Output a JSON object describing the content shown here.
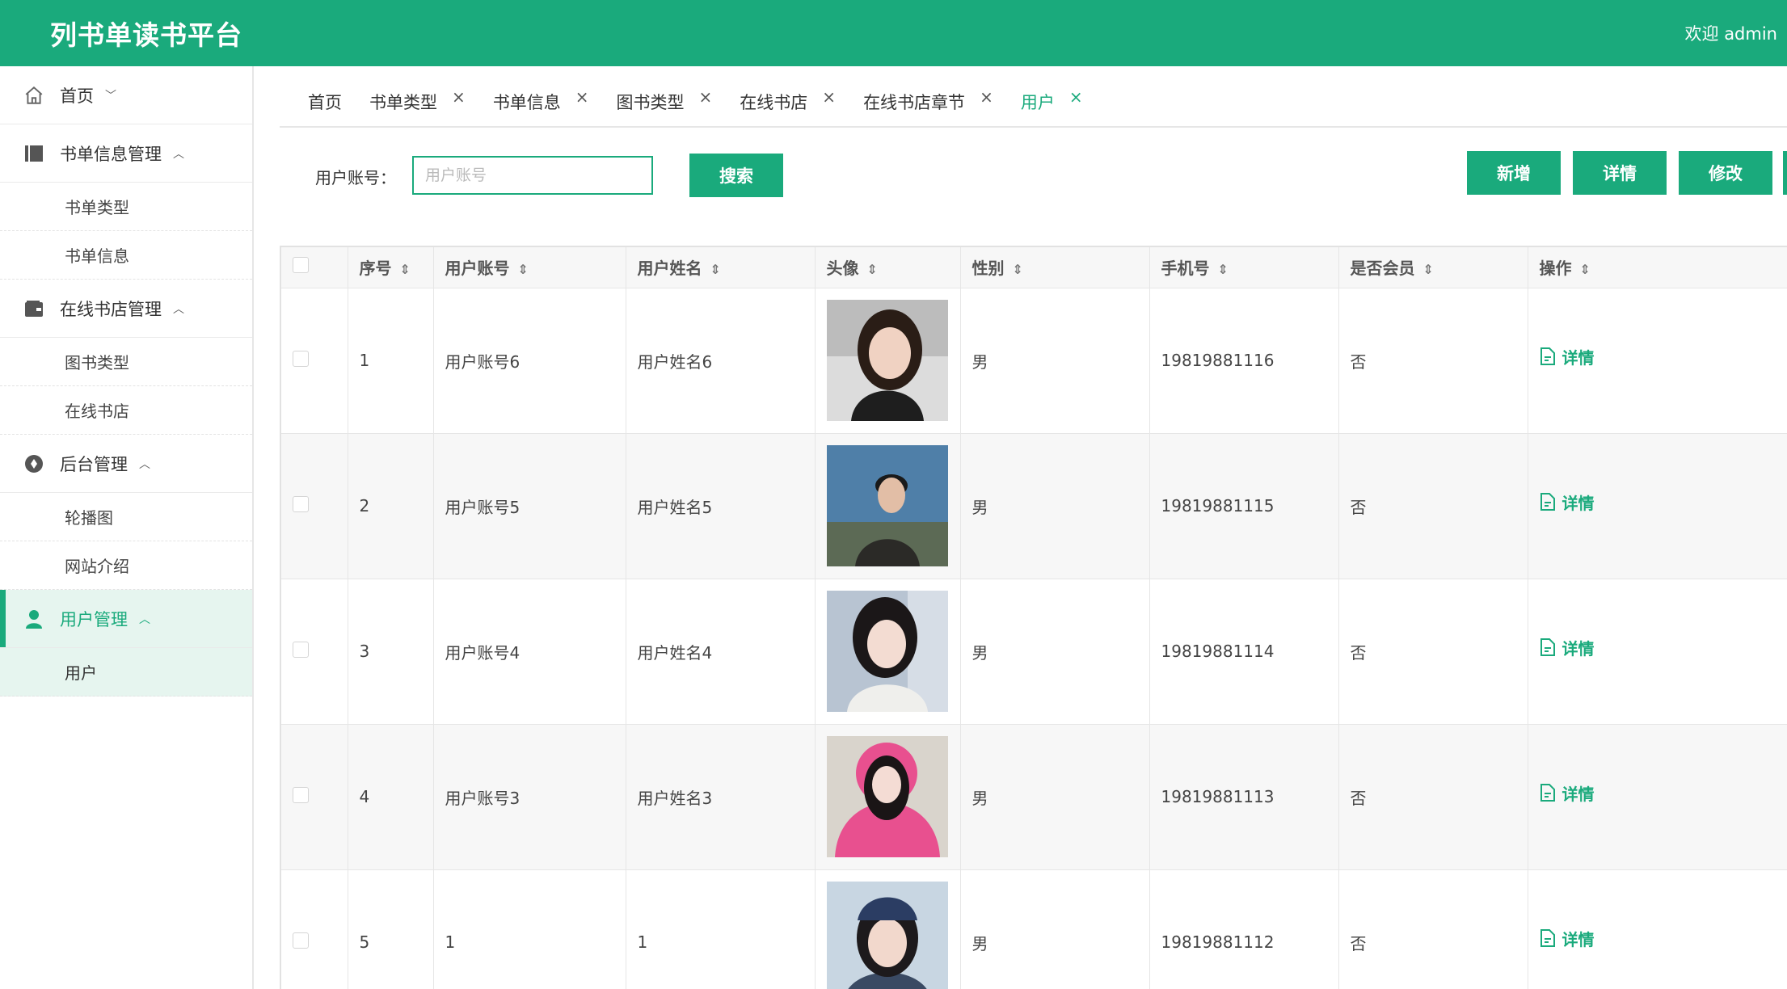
{
  "header": {
    "title": "列书单读书平台",
    "welcome": "欢迎 admin"
  },
  "sidebar": {
    "home": "首页",
    "groups": [
      {
        "label": "书单信息管理",
        "items": [
          "书单类型",
          "书单信息"
        ]
      },
      {
        "label": "在线书店管理",
        "items": [
          "图书类型",
          "在线书店"
        ]
      },
      {
        "label": "后台管理",
        "items": [
          "轮播图",
          "网站介绍"
        ]
      },
      {
        "label": "用户管理",
        "items": [
          "用户"
        ]
      }
    ]
  },
  "tabs": [
    "首页",
    "书单类型",
    "书单信息",
    "图书类型",
    "在线书店",
    "在线书店章节",
    "用户"
  ],
  "tab_close": "×",
  "search": {
    "label": "用户账号：",
    "placeholder": "用户账号",
    "button": "搜索"
  },
  "toolbar": {
    "add": "新增",
    "detail": "详情",
    "edit": "修改"
  },
  "table": {
    "columns": [
      "序号",
      "用户账号",
      "用户姓名",
      "头像",
      "性别",
      "手机号",
      "是否会员",
      "操作"
    ],
    "sort_icon": "⇕",
    "op_label": "详情",
    "rows": [
      {
        "no": "1",
        "account": "用户账号6",
        "name": "用户姓名6",
        "gender": "男",
        "phone": "19819881116",
        "member": "否"
      },
      {
        "no": "2",
        "account": "用户账号5",
        "name": "用户姓名5",
        "gender": "男",
        "phone": "19819881115",
        "member": "否"
      },
      {
        "no": "3",
        "account": "用户账号4",
        "name": "用户姓名4",
        "gender": "男",
        "phone": "19819881114",
        "member": "否"
      },
      {
        "no": "4",
        "account": "用户账号3",
        "name": "用户姓名3",
        "gender": "男",
        "phone": "19819881113",
        "member": "否"
      },
      {
        "no": "5",
        "account": "1",
        "name": "1",
        "gender": "男",
        "phone": "19819881112",
        "member": "否"
      }
    ]
  },
  "colors": {
    "primary": "#1aaa7c",
    "active_bg": "#e6f5ef"
  }
}
